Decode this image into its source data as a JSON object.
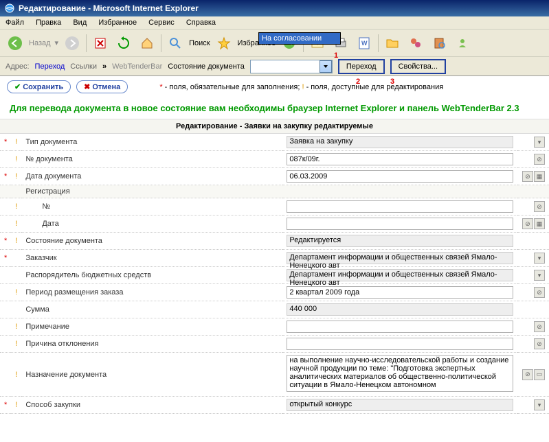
{
  "title": "Редактирование - Microsoft Internet Explorer",
  "menubar": {
    "file": "Файл",
    "edit": "Правка",
    "view": "Вид",
    "favorites": "Избранное",
    "tools": "Сервис",
    "help": "Справка"
  },
  "toolbar": {
    "back": "Назад",
    "search": "Поиск",
    "favorites": "Избранное"
  },
  "addrbar": {
    "addr_label": "Адрес:",
    "perehod": "Переход",
    "links": "Ссылки",
    "wtb": "WebTenderBar",
    "state_label": "Состояние документа",
    "state_value": "",
    "dropdown_item": "На согласовании",
    "go_btn": "Переход",
    "props_btn": "Свойства...",
    "m1": "1",
    "m2": "2",
    "m3": "3"
  },
  "actions": {
    "save": "Сохранить",
    "cancel": "Отмена"
  },
  "legend": {
    "star": "*",
    "req_text": " - поля, обязательные для заполнения;  ",
    "excl": "!",
    "edit_text": " - поля, доступные для редактирования"
  },
  "notice": "Для перевода документа в новое состояние вам необходимы браузер Internet Explorer и панель WebTenderBar 2.3",
  "section_title": "Редактирование - Заявки на закупку редактируемые",
  "rows": {
    "doc_type": {
      "label": "Тип документа",
      "value": "Заявка на закупку"
    },
    "doc_num": {
      "label": "№ документа",
      "value": "087к/09г."
    },
    "doc_date": {
      "label": "Дата документа",
      "value": "06.03.2009"
    },
    "registration": {
      "label": "Регистрация"
    },
    "reg_num": {
      "label": "№",
      "value": ""
    },
    "reg_date": {
      "label": "Дата",
      "value": ""
    },
    "state": {
      "label": "Состояние документа",
      "value": "Редактируется"
    },
    "customer": {
      "label": "Заказчик",
      "value": "Департамент информации и общественных связей Ямало-Ненецкого авт"
    },
    "budget_mgr": {
      "label": "Распорядитель бюджетных средств",
      "value": "Департамент информации и общественных связей Ямало-Ненецкого авт"
    },
    "period": {
      "label": "Период размещения заказа",
      "value": "2 квартал 2009 года"
    },
    "sum": {
      "label": "Сумма",
      "value": "440 000"
    },
    "note": {
      "label": "Примечание",
      "value": ""
    },
    "reject": {
      "label": "Причина отклонения",
      "value": ""
    },
    "purpose": {
      "label": "Назначение документа",
      "value": "на выполнение научно-исследовательской работы и создание научной продукции по теме: \"Подготовка экспертных аналитических материалов об общественно-политической ситуации в Ямало-Ненецком автономном"
    },
    "method": {
      "label": "Способ закупки",
      "value": "открытый конкурс"
    }
  }
}
